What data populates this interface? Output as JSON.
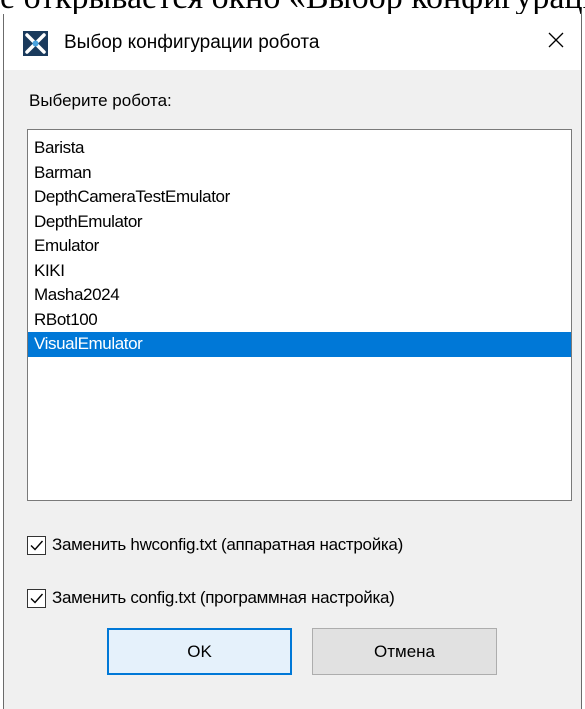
{
  "background": {
    "caption": "е открывается окно «Выбор конфигурации"
  },
  "window": {
    "title": "Выбор конфигурации робота",
    "icon": "robot-config-app-icon",
    "close_icon": "close-icon"
  },
  "prompt": "Выберите робота:",
  "robots": [
    "Barista",
    "Barman",
    "DepthCameraTestEmulator",
    "DepthEmulator",
    "Emulator",
    "KIKI",
    "Masha2024",
    "RBot100",
    "VisualEmulator"
  ],
  "selected_robot": "VisualEmulator",
  "options": [
    {
      "label": "Заменить hwconfig.txt (аппаратная настройка)",
      "checked": true
    },
    {
      "label": "Заменить config.txt (программная настройка)",
      "checked": true
    }
  ],
  "buttons": {
    "ok": "OK",
    "cancel": "Отмена"
  },
  "colors": {
    "selection": "#0078d7",
    "dialog_bg": "#f0f0f0",
    "default_button_border": "#0078d7"
  }
}
